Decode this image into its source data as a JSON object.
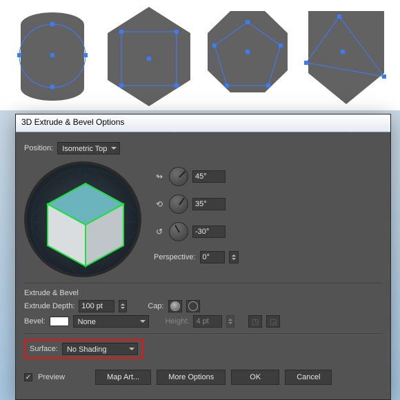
{
  "dialog": {
    "title": "3D Extrude & Bevel Options",
    "position_label": "Position:",
    "position_value": "Isometric Top",
    "rot_x": "45°",
    "rot_y": "35°",
    "rot_z": "-30°",
    "perspective_label": "Perspective:",
    "perspective_value": "0°",
    "section_extrude": "Extrude & Bevel",
    "extrude_depth_label": "Extrude Depth:",
    "extrude_depth_value": "100 pt",
    "cap_label": "Cap:",
    "bevel_label": "Bevel:",
    "bevel_value": "None",
    "height_label": "Height:",
    "height_value": "4 pt",
    "surface_label": "Surface:",
    "surface_value": "No Shading",
    "preview": "Preview",
    "btn_map": "Map Art...",
    "btn_more": "More Options",
    "btn_ok": "OK",
    "btn_cancel": "Cancel"
  },
  "colors": {
    "shape_fill": "#626262",
    "selection": "#3b7cff"
  }
}
